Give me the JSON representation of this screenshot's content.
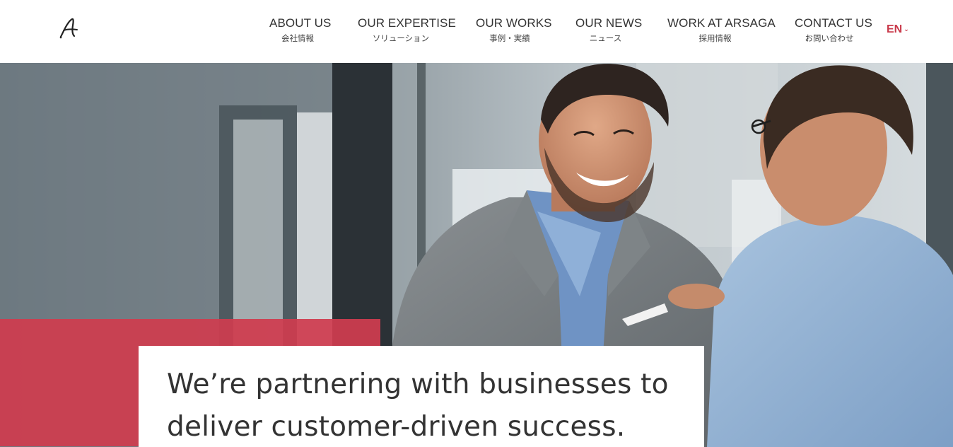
{
  "header": {
    "logo_alt": "A",
    "nav": [
      {
        "en": "ABOUT US",
        "jp": "会社情報"
      },
      {
        "en": "OUR EXPERTISE",
        "jp": "ソリューション"
      },
      {
        "en": "OUR WORKS",
        "jp": "事例・実績"
      },
      {
        "en": "OUR NEWS",
        "jp": "ニュース"
      },
      {
        "en": "WORK AT ARSAGA",
        "jp": "採用情報"
      },
      {
        "en": "CONTACT US",
        "jp": "お問い合わせ"
      }
    ],
    "language": "EN",
    "language_caret": "⌄"
  },
  "hero": {
    "headline_line1": "We’re partnering with businesses to",
    "headline_line2": "deliver customer-driven success."
  },
  "colors": {
    "accent": "#c9394a",
    "red_block": "#cf3c4f",
    "text": "#333333"
  },
  "icons": {
    "logo": "script-a-logo-icon",
    "lang_caret": "chevron-down-icon"
  }
}
